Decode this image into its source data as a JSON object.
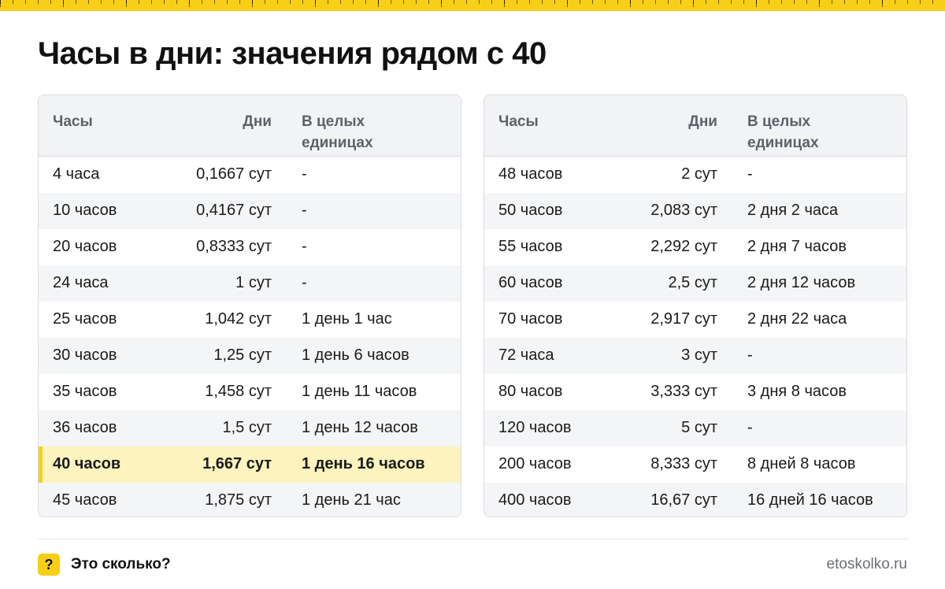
{
  "title": "Часы в дни: значения рядом с 40",
  "headers": {
    "hours": "Часы",
    "days": "Дни",
    "whole_units": "В целых единицах"
  },
  "left_table": [
    {
      "hours": "4 часа",
      "days": "0,1667 сут",
      "whole": "-"
    },
    {
      "hours": "10 часов",
      "days": "0,4167 сут",
      "whole": "-"
    },
    {
      "hours": "20 часов",
      "days": "0,8333 сут",
      "whole": "-"
    },
    {
      "hours": "24 часа",
      "days": "1 сут",
      "whole": "-"
    },
    {
      "hours": "25 часов",
      "days": "1,042 сут",
      "whole": "1 день 1 час"
    },
    {
      "hours": "30 часов",
      "days": "1,25 сут",
      "whole": "1 день 6 часов"
    },
    {
      "hours": "35 часов",
      "days": "1,458 сут",
      "whole": "1 день 11 часов"
    },
    {
      "hours": "36 часов",
      "days": "1,5 сут",
      "whole": "1 день 12 часов"
    },
    {
      "hours": "40 часов",
      "days": "1,667 сут",
      "whole": "1 день 16 часов"
    },
    {
      "hours": "45 часов",
      "days": "1,875 сут",
      "whole": "1 день 21 час"
    }
  ],
  "right_table": [
    {
      "hours": "48 часов",
      "days": "2 сут",
      "whole": "-"
    },
    {
      "hours": "50 часов",
      "days": "2,083 сут",
      "whole": "2 дня 2 часа"
    },
    {
      "hours": "55 часов",
      "days": "2,292 сут",
      "whole": "2 дня 7 часов"
    },
    {
      "hours": "60 часов",
      "days": "2,5 сут",
      "whole": "2 дня 12 часов"
    },
    {
      "hours": "70 часов",
      "days": "2,917 сут",
      "whole": "2 дня 22 часа"
    },
    {
      "hours": "72 часа",
      "days": "3 сут",
      "whole": "-"
    },
    {
      "hours": "80 часов",
      "days": "3,333 сут",
      "whole": "3 дня 8 часов"
    },
    {
      "hours": "120 часов",
      "days": "5 сут",
      "whole": "-"
    },
    {
      "hours": "200 часов",
      "days": "8,333 сут",
      "whole": "8 дней 8 часов"
    },
    {
      "hours": "400 часов",
      "days": "16,67 сут",
      "whole": "16 дней 16 часов"
    }
  ],
  "footer": {
    "badge": "?",
    "brand": "Это сколько?",
    "site": "etoskolko.ru"
  },
  "colors": {
    "accent": "#f7cf17",
    "highlight_row": "#fdf3bf"
  }
}
